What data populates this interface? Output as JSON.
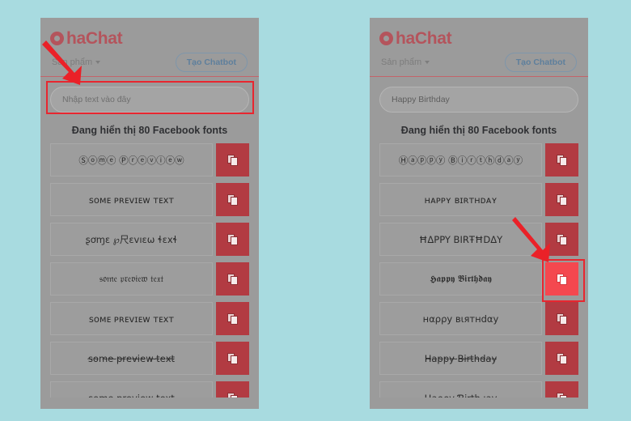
{
  "meta": {
    "page_background_color": "#a8dbe0",
    "panel_background_color": "#9b9b9b",
    "brand_color": "#b4545c",
    "accent_red": "#b23b42",
    "highlight_red": "#e8262f",
    "active_button_red": "#f4484f",
    "cta_border_color": "#7e96ab"
  },
  "panels": [
    {
      "id": "left",
      "brand": {
        "name": "haChat",
        "mark": "aha-circle-logo-icon"
      },
      "nav": {
        "product_label": "Sản phẩm",
        "caret": "chevron-down-icon"
      },
      "cta_label": "Tạo Chatbot",
      "search": {
        "value": "",
        "placeholder": "Nhập text vào đây",
        "highlighted": true
      },
      "heading": "Đang hiển thị 80 Facebook fonts",
      "copy_icon_name": "copy-icon",
      "font_rows": [
        {
          "preview": "Ⓢⓞⓜⓔ Ⓟⓡⓔⓥⓘⓔⓦ",
          "copy_active": false
        },
        {
          "preview": "ѕᴏᴍᴇ ᴘʀᴇᴠɪᴇᴡ ᴛᴇxᴛ",
          "copy_active": false
        },
        {
          "preview": "ʂơɱɛ ℘尺ɛvıɛω ɬɛxɬ",
          "copy_active": false
        },
        {
          "preview": "𝔰𝔬𝔪𝔢 𝔭𝔯𝔢𝔳𝔦𝔢𝔴 𝔱𝔢𝔵𝔱",
          "copy_active": false
        },
        {
          "preview": "ꜱᴏᴍᴇ ᴘʀᴇᴠɪᴇᴡ ᴛᴇxᴛ",
          "copy_active": false
        },
        {
          "preview": "s̴o̴m̴e̴ ̴p̴r̴e̴v̴i̴e̴w̴ ̴t̴e̴x̴t̴",
          "copy_active": false
        },
        {
          "preview": "some preview text",
          "copy_active": false
        }
      ],
      "annotations": {
        "arrow": {
          "name": "red-arrow-pointing-to-search-input",
          "color": "#e8262f"
        },
        "highlight": {
          "name": "search-input-highlight-box",
          "color": "#e8262f"
        }
      }
    },
    {
      "id": "right",
      "brand": {
        "name": "haChat",
        "mark": "aha-circle-logo-icon"
      },
      "nav": {
        "product_label": "Sản phẩm",
        "caret": "chevron-down-icon"
      },
      "cta_label": "Tạo Chatbot",
      "search": {
        "value": "Happy Birthday",
        "placeholder": "Nhập text vào đây",
        "highlighted": false
      },
      "heading": "Đang hiển thị 80 Facebook fonts",
      "copy_icon_name": "copy-icon",
      "font_rows": [
        {
          "preview": "Ⓗⓐⓟⓟⓨ Ⓑⓘⓡⓣⓗⓓⓐⓨ",
          "copy_active": false
        },
        {
          "preview": "ʜᴀᴘᴘʏ ʙɪʀᴛʜᴅᴀʏ",
          "copy_active": false
        },
        {
          "preview": "ĦΔPPY BIRŦĦDΔY",
          "copy_active": false
        },
        {
          "preview": "𝕳𝖆𝖕𝖕𝖞 𝕭𝖎𝖗𝖙𝖍𝖉𝖆𝖞",
          "copy_active": true
        },
        {
          "preview": "нαρρу вιятнdαу",
          "copy_active": false
        },
        {
          "preview": "H̴a̴p̴p̴y̴ ̴B̴i̴r̴t̴h̴d̴a̴y̴",
          "copy_active": false
        },
        {
          "preview": "Ӊaρρy Ɓirthԁay",
          "copy_active": false
        }
      ],
      "annotations": {
        "arrow": {
          "name": "red-arrow-pointing-to-copy-button",
          "color": "#e8262f"
        },
        "highlight": {
          "name": "copy-button-highlight-box",
          "color": "#e8262f"
        }
      }
    }
  ]
}
